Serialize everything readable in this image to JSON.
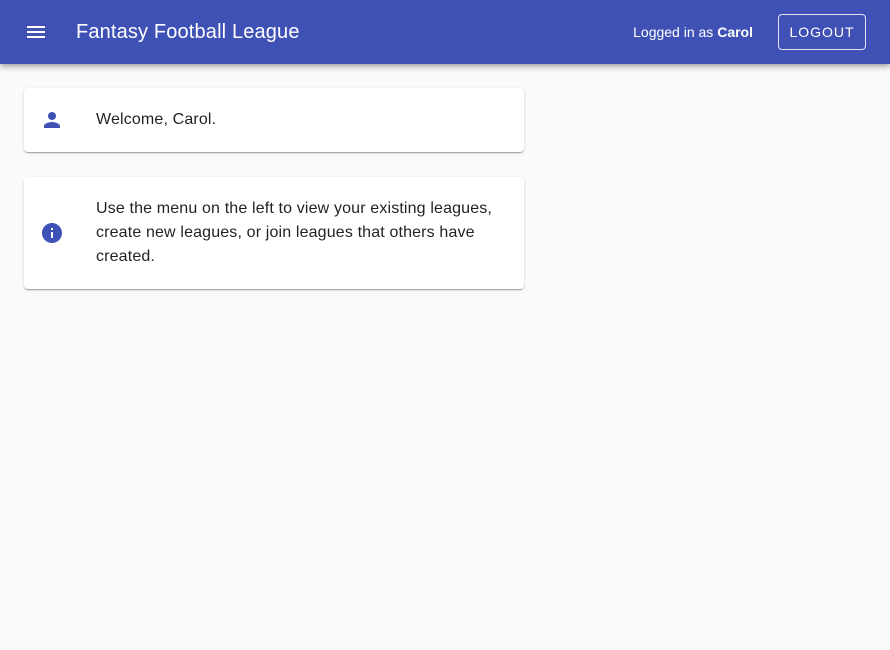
{
  "app_bar": {
    "menu_icon": "menu-icon",
    "title": "Fantasy Football League",
    "login_prefix": "Logged in as ",
    "username": "Carol",
    "logout_label": "LOGOUT",
    "background_color": "#3f51b5",
    "text_color": "#ffffff"
  },
  "cards": {
    "welcome": {
      "icon": "person-icon",
      "text": "Welcome, Carol."
    },
    "info": {
      "icon": "info-icon",
      "text": "Use the menu on the left to view your existing leagues, create new leagues, or join leagues that others have created."
    }
  },
  "colors": {
    "primary": "#3f51b5",
    "page_background": "#fafafa",
    "card_background": "#ffffff"
  }
}
